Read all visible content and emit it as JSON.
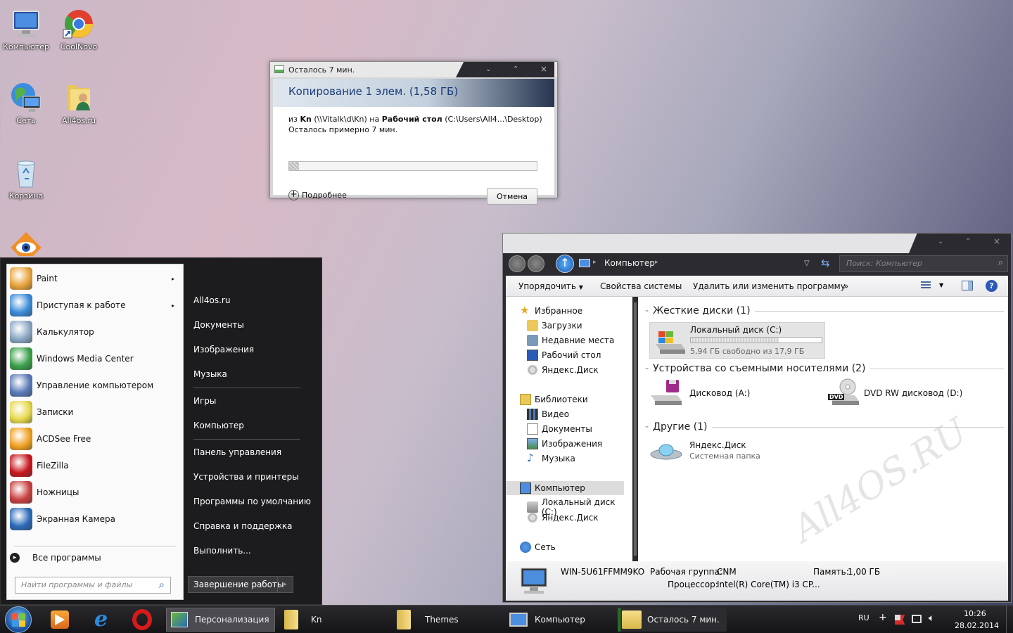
{
  "desktop": {
    "icons": [
      {
        "label": "Компьютер"
      },
      {
        "label": "CoolNovo"
      },
      {
        "label": "Сеть"
      },
      {
        "label": "All4os.ru"
      },
      {
        "label": "Корзина"
      }
    ]
  },
  "copy_dialog": {
    "title": "Осталось 7 мин.",
    "heading": "Копирование 1 элем. (1,58 ГБ)",
    "from_prefix": "из",
    "from_name": "Kn",
    "from_path": "(\\\\Vitalk\\d\\Kn)",
    "to_prefix": "на",
    "to_name": "Рабочий стол",
    "to_path": "(C:\\Users\\All4...\\Desktop)",
    "remaining": "Осталось примерно 7 мин.",
    "progress": 0.04,
    "details": "Подробнее",
    "cancel": "Отмена"
  },
  "start_menu": {
    "programs": [
      {
        "label": "Paint",
        "arrow": "▸",
        "color": "#e8a23a"
      },
      {
        "label": "Приступая к работе",
        "arrow": "▸",
        "color": "#3a8ad8"
      },
      {
        "label": "Калькулятор",
        "arrow": "",
        "color": "#8aa6c4"
      },
      {
        "label": "Windows Media Center",
        "arrow": "",
        "color": "#3aa04a"
      },
      {
        "label": "Управление компьютером",
        "arrow": "",
        "color": "#5a7ab8"
      },
      {
        "label": "Записки",
        "arrow": "",
        "color": "#e6d84a"
      },
      {
        "label": "ACDSee Free",
        "arrow": "",
        "color": "#f0a020"
      },
      {
        "label": "FileZilla",
        "arrow": "",
        "color": "#c8161d"
      },
      {
        "label": "Ножницы",
        "arrow": "",
        "color": "#c84040"
      },
      {
        "label": "Экранная Камера",
        "arrow": "",
        "color": "#2a6ab8"
      }
    ],
    "all_programs": "Все программы",
    "search_placeholder": "Найти программы и файлы",
    "right": [
      "All4os.ru",
      "Документы",
      "Изображения",
      "Музыка",
      "Игры",
      "Компьютер",
      "Панель управления",
      "Устройства и принтеры",
      "Программы по умолчанию",
      "Справка и поддержка",
      "Выполнить..."
    ],
    "shutdown": "Завершение работы",
    "shutdown_arrow": "▸"
  },
  "explorer": {
    "crumb": "Компьютер",
    "crumb_sep": "▸",
    "search_placeholder": "Поиск: Компьютер",
    "toolbar": {
      "organize": "Упорядочить",
      "system_props": "Свойства системы",
      "uninstall": "Удалить или изменить программу",
      "more": "»"
    },
    "nav": {
      "favorites": "Избранное",
      "downloads": "Загрузки",
      "recent": "Недавние места",
      "desktop": "Рабочий стол",
      "yadisk1": "Яндекс.Диск",
      "libraries": "Библиотеки",
      "video": "Видео",
      "documents": "Документы",
      "images": "Изображения",
      "music": "Музыка",
      "computer": "Компьютер",
      "local_c": "Локальный диск (C:)",
      "yadisk2": "Яндекс.Диск",
      "network": "Сеть"
    },
    "groups": {
      "hdd": "Жесткие диски (1)",
      "removable": "Устройства со съемными носителями (2)",
      "other": "Другие (1)"
    },
    "drive_c": {
      "name": "Локальный диск (C:)",
      "free": "5,94 ГБ свободно из 17,9 ГБ",
      "used_fraction": 0.67
    },
    "floppy": "Дисковод (A:)",
    "dvd": "DVD RW дисковод (D:)",
    "dvd_badge": "DVD",
    "yadisk": {
      "name": "Яндекс.Диск",
      "type": "Системная папка"
    },
    "status": {
      "pc": "WIN-5U61FFMM9KO",
      "workgroup_label": "Рабочая группа:",
      "workgroup": "CNM",
      "memory_label": "Память:",
      "memory": "1,00 ГБ",
      "cpu_label": "Процессор:",
      "cpu": "Intel(R) Core(TM) i3 CP..."
    },
    "watermark": "All4OS.RU"
  },
  "taskbar": {
    "buttons": [
      "Персонализация",
      "Kn",
      "Themes",
      "Компьютер",
      "Осталось 7 мин."
    ],
    "lang": "RU",
    "time": "10:26",
    "date": "28.02.2014"
  },
  "window_controls": {
    "minimize": "⌄",
    "maximize": "⌃",
    "close": "×"
  }
}
